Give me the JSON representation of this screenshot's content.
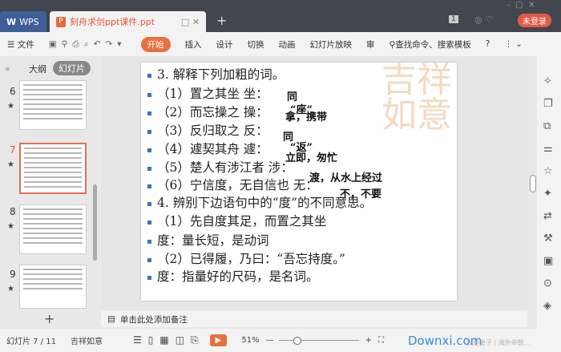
{
  "tabs": {
    "wps": "WPS",
    "doc": "刻舟求剑ppt课件.ppt",
    "new": "+"
  },
  "titlebar": {
    "badge": "1",
    "login": "未登录"
  },
  "toolbar": {
    "menu": "☰ 文件",
    "items": [
      "开始",
      "插入",
      "设计",
      "切换",
      "动画",
      "幻灯片放映",
      "审"
    ],
    "search": "查找命令、搜索模板",
    "help": "?"
  },
  "leftpanel": {
    "outline": "大纲",
    "slides": "幻灯片",
    "numbers": [
      "6",
      "7",
      "8",
      "9"
    ],
    "add": "+"
  },
  "slide": {
    "lines": [
      "3. 解释下列加粗的词。",
      "（1）置之其坐  坐：",
      "（2）而忘操之  操：",
      "（3）反归取之  反：",
      "（4）遽契其舟  遽：",
      "（5）楚人有涉江者  涉：",
      "（6）宁信度，无自信也  无：",
      "4. 辨别下边语句中的“度”的不同意思。",
      "（1）先自度其足，而置之其坐",
      "度：量长短，是动词",
      "（2）已得履，乃曰：“吾忘持度。”",
      "度：指量好的尺码，是名词。"
    ],
    "annotations": [
      "同",
      "“座”",
      "拿，携带",
      "同",
      "“返”",
      "立即，匆忙",
      "渡，从水上经过",
      "不，不要"
    ],
    "deco": "吉祥如意"
  },
  "notes": {
    "placeholder": "单击此处添加备注"
  },
  "status": {
    "slide": "幻灯片 7 / 11",
    "theme": "吉祥如意",
    "zoom": "51%",
    "zoom_value": 51,
    "watermark": "Downxi.com",
    "ad": "我是皇子 | 海外帝朝..."
  },
  "accent": "#e8703f"
}
